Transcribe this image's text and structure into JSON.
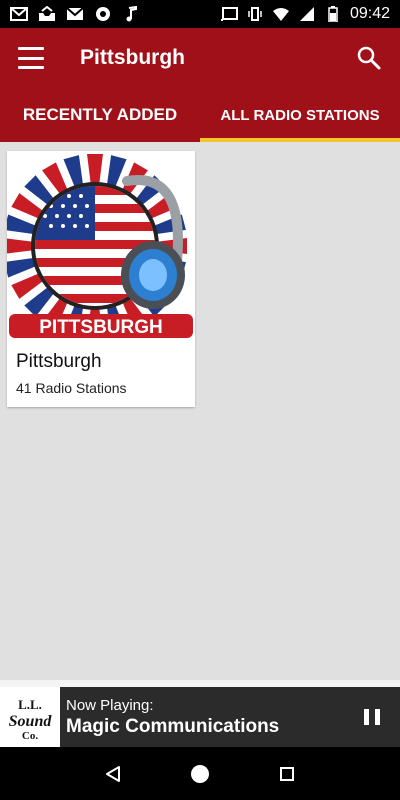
{
  "status_bar": {
    "time": "09:42",
    "left_icons": [
      "mail-icon",
      "inbox-icon",
      "gmail-icon",
      "aperture-icon",
      "music-note-icon"
    ],
    "right_icons": [
      "cast-icon",
      "vibrate-icon",
      "wifi-icon",
      "signal-icon",
      "battery-icon"
    ]
  },
  "app_bar": {
    "title": "Pittsburgh"
  },
  "tabs": [
    {
      "label": "RECENTLY ADDED",
      "active": false
    },
    {
      "label": "ALL RADIO STATIONS",
      "active": true
    }
  ],
  "cards": [
    {
      "title": "Pittsburgh",
      "subtitle": "41 Radio Stations",
      "banner_text": "PITTSBURGH"
    }
  ],
  "now_playing": {
    "label": "Now Playing:",
    "station": "Magic Communications",
    "logo_text": "L.L. Sound Co."
  },
  "colors": {
    "primary": "#a01018",
    "tab_indicator": "#f2c72e",
    "player_bg": "#2b2b2b"
  }
}
